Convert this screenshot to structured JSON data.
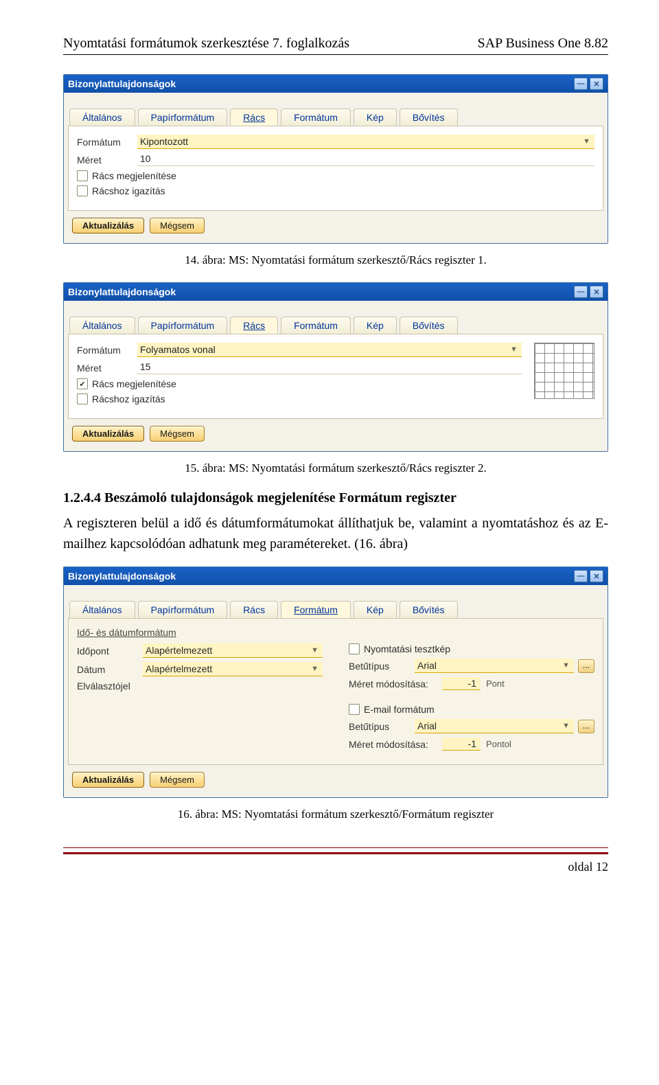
{
  "header": {
    "left": "Nyomtatási formátumok szerkesztése 7. foglalkozás",
    "right": "SAP Business One 8.82"
  },
  "dlg": {
    "title": "Bizonylattulajdonságok",
    "tabs": {
      "t0": "Általános",
      "t1": "Papírformátum",
      "t2": "Rács",
      "t3": "Formátum",
      "t4": "Kép",
      "t5": "Bővítés",
      "t0u": "Á",
      "t1u": "P",
      "t2u": "R",
      "t3u": "F",
      "t4u": "K",
      "t5u": "B"
    },
    "fields": {
      "formatum": "Formátum",
      "meret": "Méret",
      "racsshow": "Rács megjelenítése",
      "racssnap": "Rácshoz igazítás"
    },
    "buttons": {
      "update": "Aktualizálás",
      "cancel": "Mégsem"
    }
  },
  "dlg1": {
    "format_val": "Kipontozott",
    "size_val": "10",
    "show_checked": false,
    "snap_checked": false
  },
  "dlg2": {
    "format_val": "Folyamatos vonal",
    "size_val": "15",
    "show_checked": true,
    "snap_checked": false
  },
  "cap1": "14. ábra: MS: Nyomtatási formátum szerkesztő/Rács regiszter 1.",
  "cap2": "15. ábra: MS: Nyomtatási formátum szerkesztő/Rács regiszter 2.",
  "cap3": "16. ábra: MS: Nyomtatási formátum szerkesztő/Formátum regiszter",
  "section_head": "1.2.4.4 Beszámoló tulajdonságok megjelenítése Formátum regiszter",
  "body_para": "A regiszteren belül a idő és dátumformátumokat állíthatjuk be, valamint a nyomtatáshoz és az E-mailhez kapcsolódóan adhatunk meg paramétereket. (16. ábra)",
  "dlg3": {
    "sub_title": "Idő- és dátumformátum",
    "left": {
      "time": "Időpont",
      "time_v": "Alapértelmezett",
      "date": "Dátum",
      "date_v": "Alapértelmezett",
      "sep": "Elválasztójel",
      "sep_v": ""
    },
    "right_top": {
      "testpic": "Nyomtatási tesztkép",
      "testpic_checked": false,
      "font": "Betűtípus",
      "font_v": "Arial",
      "size": "Méret módosítása:",
      "size_v": "-1",
      "size_unit": "Pont"
    },
    "right_bot": {
      "emailfmt": "E-mail formátum",
      "emailfmt_checked": false,
      "font": "Betűtípus",
      "font_v": "Arial",
      "size": "Méret módosítása:",
      "size_v": "-1",
      "size_unit": "Pontol"
    }
  },
  "footer": "oldal 12"
}
